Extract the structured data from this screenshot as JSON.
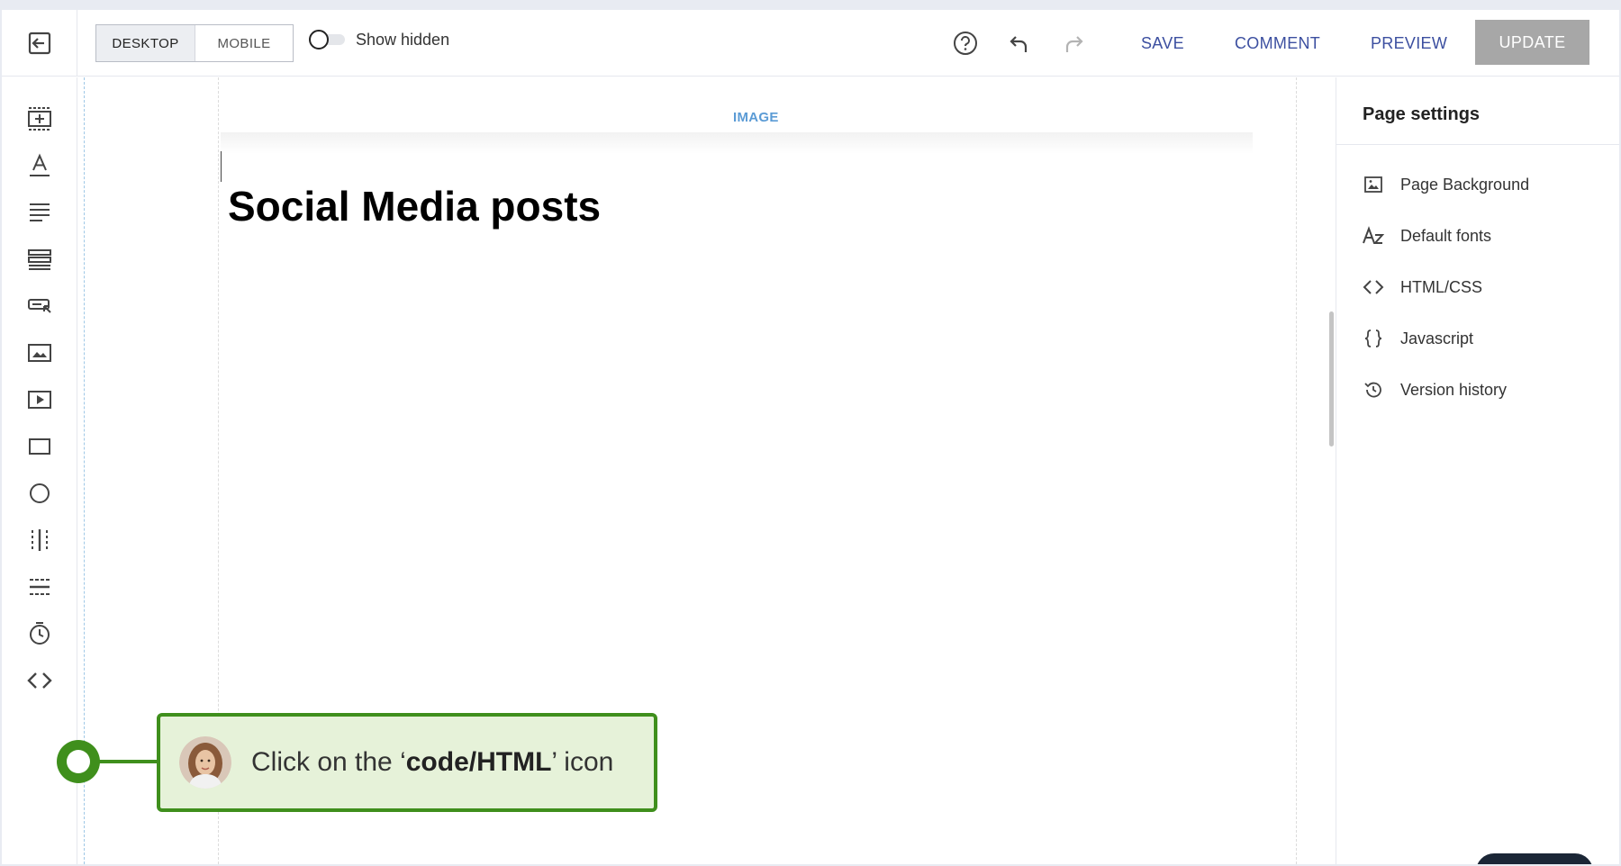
{
  "toolbar": {
    "device_tabs": [
      "DESKTOP",
      "MOBILE"
    ],
    "active_device": "DESKTOP",
    "show_hidden_label": "Show hidden",
    "show_hidden_enabled": false,
    "save_label": "SAVE",
    "comment_label": "COMMENT",
    "preview_label": "PREVIEW",
    "update_label": "UPDATE",
    "link_color": "#3c4fa0",
    "update_color": "#a7a7a7"
  },
  "tools": [
    {
      "name": "add-section-icon"
    },
    {
      "name": "text-icon"
    },
    {
      "name": "paragraph-icon"
    },
    {
      "name": "list-icon"
    },
    {
      "name": "button-icon"
    },
    {
      "name": "image-icon"
    },
    {
      "name": "video-icon"
    },
    {
      "name": "box-icon"
    },
    {
      "name": "circle-icon"
    },
    {
      "name": "columns-icon"
    },
    {
      "name": "divider-icon"
    },
    {
      "name": "timer-icon"
    },
    {
      "name": "code-icon"
    }
  ],
  "canvas": {
    "section_label": "IMAGE",
    "heading": "Social Media posts",
    "section_label_color": "#5b9bd5"
  },
  "settings": {
    "title": "Page settings",
    "items": [
      {
        "label": "Page Background",
        "icon": "image-icon"
      },
      {
        "label": "Default fonts",
        "icon": "font-icon"
      },
      {
        "label": "HTML/CSS",
        "icon": "code-icon"
      },
      {
        "label": "Javascript",
        "icon": "braces-icon"
      },
      {
        "label": "Version history",
        "icon": "history-icon"
      }
    ]
  },
  "callout": {
    "prefix": "Click on the ‘",
    "bold": "code/HTML",
    "suffix": "’ icon",
    "accent_color": "#3f8f1c",
    "background_color": "#e6f2d9"
  }
}
